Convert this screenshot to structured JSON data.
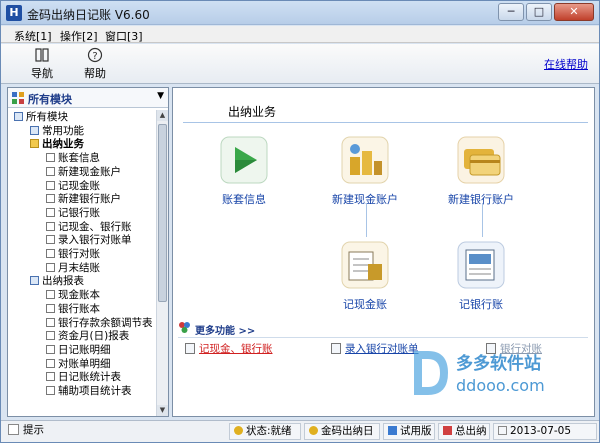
{
  "window": {
    "title": "金码出纳日记账 V6.60",
    "minimize": "─",
    "maximize": "□",
    "close": "✕"
  },
  "menu": [
    "系统[1]",
    "操作[2]",
    "窗口[3]"
  ],
  "toolbar": {
    "nav_label": "导航",
    "help_label": "帮助",
    "online_help": "在线帮助"
  },
  "left_panel": {
    "module_selector": "所有模块",
    "tree": [
      {
        "label": "所有模块",
        "level": 0,
        "icon": "gear-folder-icon",
        "bold": false
      },
      {
        "label": "常用功能",
        "level": 1,
        "icon": "gear-icon",
        "bold": false
      },
      {
        "label": "出纳业务",
        "level": 1,
        "icon": "open-folder-icon",
        "bold": true
      },
      {
        "label": "账套信息",
        "level": 2,
        "icon": "document-icon",
        "bold": false
      },
      {
        "label": "新建现金账户",
        "level": 2,
        "icon": "document-icon",
        "bold": false
      },
      {
        "label": "记现金账",
        "level": 2,
        "icon": "document-icon",
        "bold": false
      },
      {
        "label": "新建银行账户",
        "level": 2,
        "icon": "document-icon",
        "bold": false
      },
      {
        "label": "记银行账",
        "level": 2,
        "icon": "document-icon",
        "bold": false
      },
      {
        "label": "记现金、银行账",
        "level": 2,
        "icon": "document-icon",
        "bold": false
      },
      {
        "label": "录入银行对账单",
        "level": 2,
        "icon": "document-icon",
        "bold": false
      },
      {
        "label": "银行对账",
        "level": 2,
        "icon": "document-icon",
        "bold": false
      },
      {
        "label": "月末结账",
        "level": 2,
        "icon": "document-icon",
        "bold": false
      },
      {
        "label": "出纳报表",
        "level": 1,
        "icon": "report-folder-icon",
        "bold": false
      },
      {
        "label": "现金账本",
        "level": 2,
        "icon": "document-icon",
        "bold": false
      },
      {
        "label": "银行账本",
        "level": 2,
        "icon": "document-icon",
        "bold": false
      },
      {
        "label": "银行存款余额调节表",
        "level": 2,
        "icon": "document-icon",
        "bold": false
      },
      {
        "label": "资金月(日)报表",
        "level": 2,
        "icon": "document-icon",
        "bold": false
      },
      {
        "label": "日记账明细",
        "level": 2,
        "icon": "document-icon",
        "bold": false
      },
      {
        "label": "对账单明细",
        "level": 2,
        "icon": "document-icon",
        "bold": false
      },
      {
        "label": "日记账统计表",
        "level": 2,
        "icon": "document-icon",
        "bold": false
      },
      {
        "label": "辅助项目统计表",
        "level": 2,
        "icon": "document-icon",
        "bold": false
      }
    ]
  },
  "main": {
    "section_title": "出纳业务",
    "cards": [
      {
        "label": "账套信息",
        "icon": "play-triangle-icon",
        "color": "#3aa84a"
      },
      {
        "label": "新建现金账户",
        "icon": "coins-icon",
        "color": "#d8a62a"
      },
      {
        "label": "新建银行账户",
        "icon": "bank-card-icon",
        "color": "#e3b33b"
      },
      {
        "label": "记现金账",
        "icon": "cash-ledger-icon",
        "color": "#c89a2a"
      },
      {
        "label": "记银行账",
        "icon": "bank-ledger-icon",
        "color": "#5a8fc8"
      }
    ],
    "more_title": "更多功能 >>",
    "quick_links": [
      {
        "label": "记现金、银行账",
        "color": "#d02020"
      },
      {
        "label": "录入银行对账单",
        "color": "#1744a8"
      },
      {
        "label": "银行对账",
        "color": "#8a9ab0"
      }
    ],
    "watermark": {
      "line1": "多多软件站",
      "line2": "ddooo.com"
    }
  },
  "status": {
    "hint": "提示",
    "state": "状态:就绪",
    "app": "金码出纳日",
    "version": "试用版",
    "account": "总出纳",
    "date": "2013-07-05"
  }
}
